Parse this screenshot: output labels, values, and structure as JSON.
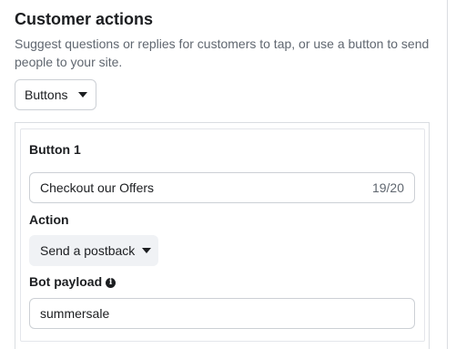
{
  "section": {
    "title": "Customer actions",
    "description": "Suggest questions or replies for customers to tap, or use a button to send people to your site."
  },
  "type_dropdown": {
    "selected": "Buttons",
    "icon": "chevron-down-icon"
  },
  "button_editor": {
    "heading": "Button 1",
    "button_text": {
      "value": "Checkout our Offers",
      "char_count": "19/20"
    },
    "action": {
      "label": "Action",
      "selected": "Send a postback",
      "icon": "chevron-down-icon"
    },
    "payload": {
      "label": "Bot payload",
      "info_icon": "info-icon",
      "value": "summersale"
    }
  }
}
